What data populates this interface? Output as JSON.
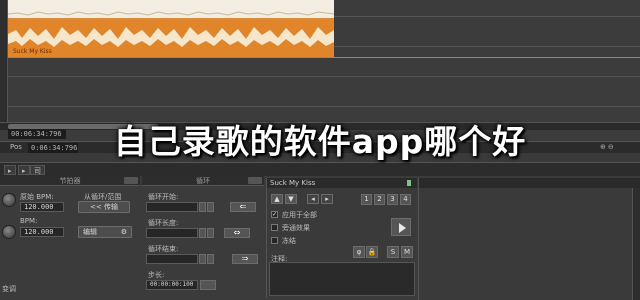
{
  "track": {
    "clip_name": "Suck My Kiss",
    "time_top": "00:06:34:796",
    "pos_label": "Pos",
    "time_pos": "0:06:34:796"
  },
  "overlay": {
    "title": "自己录歌的软件app哪个好"
  },
  "tabs": [
    "▸",
    "▸",
    "司"
  ],
  "tempo_panel": {
    "header": "节拍器",
    "orig_bpm_label": "原始 BPM:",
    "orig_bpm_value": "120.000",
    "bpm_label": "BPM:",
    "bpm_value": "120.000",
    "from_loop_label": "从循环/范围",
    "transfer_btn": "<< 传输",
    "edit_btn": "编辑",
    "bottom_label": "变调"
  },
  "loop_panel": {
    "header": "循环",
    "loop_start_label": "循环开始:",
    "loop_length_label": "循环长度:",
    "loop_end_label": "循环结束:",
    "step_label": "步长:",
    "step_value": "00:00:00:100"
  },
  "clip_panel": {
    "title": "Suck My Kiss",
    "numbers": [
      "1",
      "2",
      "3",
      "4"
    ],
    "opt_apply_all": "应用于全部",
    "opt_bypass": "旁通效果",
    "opt_freeze": "冻结",
    "solo": "S",
    "mute": "M",
    "notes_label": "注释:"
  },
  "colors": {
    "clip_top": "#f4eee2",
    "clip_bottom": "#e0852a",
    "panel_bg": "#3b3b3b"
  }
}
